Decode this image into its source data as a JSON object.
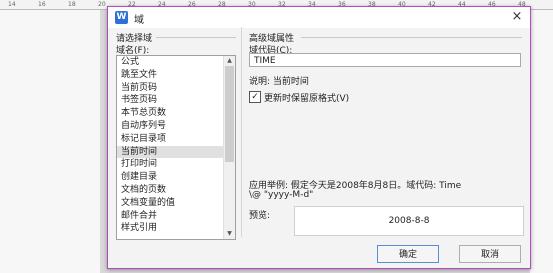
{
  "ruler": {
    "marks": [
      "14",
      "16",
      "18",
      "20",
      "22",
      "24",
      "26",
      "28",
      "30",
      "32",
      "34",
      "36",
      "38",
      "40",
      "42",
      "44",
      "46",
      "48"
    ]
  },
  "dialog": {
    "title": "域",
    "close": "×",
    "left": {
      "section_title": "请选择域",
      "list_label": "域名(F):",
      "items": [
        "公式",
        "跳至文件",
        "当前页码",
        "书签页码",
        "本节总页数",
        "自动序列号",
        "标记目录项",
        "当前时间",
        "打印时间",
        "创建目录",
        "文档的页数",
        "文档变量的值",
        "邮件合并",
        "样式引用"
      ],
      "selected_index": 7
    },
    "right": {
      "section_title": "高级域属性",
      "code_label": "域代码(C):",
      "code_value": "TIME",
      "description": "说明: 当前时间",
      "checkbox_label": "更新时保留原格式(V)",
      "checkbox_checked": true,
      "example_line1": "应用举例: 假定今天是2008年8月8日。域代码: Time",
      "example_line2": "\\@ \"yyyy-M-d\"",
      "preview_label": "预览:",
      "preview_value": "2008-8-8"
    },
    "buttons": {
      "ok": "确定",
      "cancel": "取消"
    }
  }
}
